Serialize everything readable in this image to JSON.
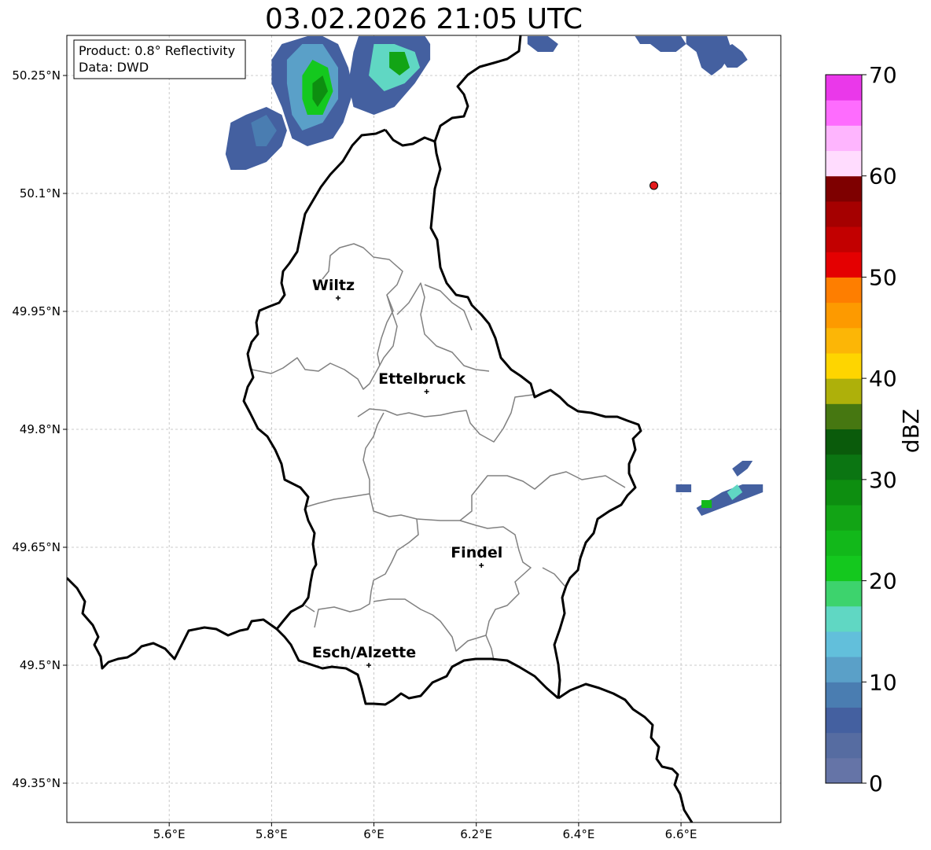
{
  "title": "03.02.2026 21:05 UTC",
  "info_box": {
    "product": "Product: 0.8° Reflectivity",
    "source": "Data: DWD"
  },
  "map": {
    "lon_range": [
      5.4,
      6.795
    ],
    "lat_range": [
      49.3,
      50.301
    ],
    "gridlines": true,
    "lon_ticks": [
      {
        "value": 5.6,
        "label": "5.6°E"
      },
      {
        "value": 5.8,
        "label": "5.8°E"
      },
      {
        "value": 6.0,
        "label": "6°E"
      },
      {
        "value": 6.2,
        "label": "6.2°E"
      },
      {
        "value": 6.4,
        "label": "6.4°E"
      },
      {
        "value": 6.6,
        "label": "6.6°E"
      }
    ],
    "lat_ticks": [
      {
        "value": 50.25,
        "label": "50.25°N"
      },
      {
        "value": 50.1,
        "label": "50.1°N"
      },
      {
        "value": 49.95,
        "label": "49.95°N"
      },
      {
        "value": 49.8,
        "label": "49.8°N"
      },
      {
        "value": 49.65,
        "label": "49.65°N"
      },
      {
        "value": 49.5,
        "label": "49.5°N"
      },
      {
        "value": 49.35,
        "label": "49.35°N"
      }
    ],
    "cities": [
      {
        "name": "Wiltz",
        "lon": 5.93,
        "lat": 49.967
      },
      {
        "name": "Ettelbruck",
        "lon": 6.103,
        "lat": 49.848
      },
      {
        "name": "Findel",
        "lon": 6.21,
        "lat": 49.627
      },
      {
        "name": "Esch/Alzette",
        "lon": 5.99,
        "lat": 49.5
      }
    ],
    "radar_site": {
      "lon": 6.547,
      "lat": 50.11,
      "color": "#e41a1c"
    }
  },
  "colorbar": {
    "label": "dBZ",
    "min": 0,
    "max": 70,
    "step": 5,
    "ticks": [
      "0",
      "10",
      "20",
      "30",
      "40",
      "50",
      "60",
      "70"
    ],
    "colors": [
      "#6574a7",
      "#566ca1",
      "#4460a0",
      "#4a7db1",
      "#5aa0c8",
      "#62bfdb",
      "#60d7c3",
      "#3dd36d",
      "#14c81e",
      "#12b81a",
      "#12a415",
      "#0d8e10",
      "#0b7512",
      "#0a5b0b",
      "#467711",
      "#aeb00a",
      "#fed500",
      "#fcb606",
      "#fd9a00",
      "#fe7e00",
      "#e40001",
      "#c20000",
      "#a50000",
      "#7e0000",
      "#ffdcfe",
      "#feb5fe",
      "#fe6cfe",
      "#ea38ea"
    ]
  },
  "radar_echoes": [
    {
      "level": 2,
      "points": [
        [
          5.8,
          50.27
        ],
        [
          5.82,
          50.29
        ],
        [
          5.87,
          50.3
        ],
        [
          5.9,
          50.3
        ],
        [
          5.93,
          50.29
        ],
        [
          5.95,
          50.26
        ],
        [
          5.96,
          50.23
        ],
        [
          5.94,
          50.19
        ],
        [
          5.92,
          50.17
        ],
        [
          5.87,
          50.16
        ],
        [
          5.84,
          50.17
        ],
        [
          5.82,
          50.21
        ],
        [
          5.8,
          50.24
        ]
      ]
    },
    {
      "level": 4,
      "points": [
        [
          5.83,
          50.27
        ],
        [
          5.86,
          50.29
        ],
        [
          5.9,
          50.29
        ],
        [
          5.93,
          50.26
        ],
        [
          5.93,
          50.22
        ],
        [
          5.9,
          50.19
        ],
        [
          5.86,
          50.18
        ],
        [
          5.84,
          50.2
        ],
        [
          5.83,
          50.24
        ]
      ]
    },
    {
      "level": 8,
      "points": [
        [
          5.86,
          50.25
        ],
        [
          5.88,
          50.27
        ],
        [
          5.91,
          50.26
        ],
        [
          5.92,
          50.23
        ],
        [
          5.9,
          50.2
        ],
        [
          5.87,
          50.2
        ],
        [
          5.86,
          50.22
        ]
      ]
    },
    {
      "level": 11,
      "points": [
        [
          5.88,
          50.24
        ],
        [
          5.9,
          50.25
        ],
        [
          5.91,
          50.23
        ],
        [
          5.89,
          50.21
        ],
        [
          5.88,
          50.22
        ]
      ]
    },
    {
      "level": 2,
      "points": [
        [
          5.72,
          50.19
        ],
        [
          5.75,
          50.2
        ],
        [
          5.79,
          50.21
        ],
        [
          5.82,
          50.2
        ],
        [
          5.83,
          50.18
        ],
        [
          5.82,
          50.16
        ],
        [
          5.79,
          50.14
        ],
        [
          5.75,
          50.13
        ],
        [
          5.72,
          50.13
        ],
        [
          5.71,
          50.15
        ]
      ]
    },
    {
      "level": 3,
      "points": [
        [
          5.76,
          50.19
        ],
        [
          5.79,
          50.2
        ],
        [
          5.81,
          50.18
        ],
        [
          5.79,
          50.16
        ],
        [
          5.77,
          50.16
        ]
      ]
    },
    {
      "level": 2,
      "points": [
        [
          5.97,
          50.3
        ],
        [
          6.01,
          50.3
        ],
        [
          6.06,
          50.3
        ],
        [
          6.1,
          50.3
        ],
        [
          6.11,
          50.29
        ],
        [
          6.11,
          50.27
        ],
        [
          6.08,
          50.24
        ],
        [
          6.04,
          50.21
        ],
        [
          6.0,
          50.2
        ],
        [
          5.96,
          50.21
        ],
        [
          5.95,
          50.24
        ],
        [
          5.96,
          50.28
        ]
      ]
    },
    {
      "level": 6,
      "points": [
        [
          6.0,
          50.29
        ],
        [
          6.04,
          50.29
        ],
        [
          6.08,
          50.28
        ],
        [
          6.09,
          50.26
        ],
        [
          6.06,
          50.24
        ],
        [
          6.02,
          50.23
        ],
        [
          5.99,
          50.25
        ]
      ]
    },
    {
      "level": 10,
      "points": [
        [
          6.03,
          50.28
        ],
        [
          6.06,
          50.28
        ],
        [
          6.07,
          50.26
        ],
        [
          6.05,
          50.25
        ],
        [
          6.03,
          50.26
        ]
      ]
    },
    {
      "level": 2,
      "points": [
        [
          6.3,
          50.3
        ],
        [
          6.34,
          50.3
        ],
        [
          6.36,
          50.29
        ],
        [
          6.35,
          50.28
        ],
        [
          6.32,
          50.28
        ],
        [
          6.3,
          50.29
        ]
      ]
    },
    {
      "level": 2,
      "points": [
        [
          6.51,
          50.3
        ],
        [
          6.55,
          50.3
        ],
        [
          6.6,
          50.3
        ],
        [
          6.61,
          50.29
        ],
        [
          6.59,
          50.28
        ],
        [
          6.56,
          50.28
        ],
        [
          6.54,
          50.29
        ],
        [
          6.52,
          50.29
        ]
      ]
    },
    {
      "level": 2,
      "points": [
        [
          6.61,
          50.3
        ],
        [
          6.66,
          50.3
        ],
        [
          6.69,
          50.3
        ],
        [
          6.7,
          50.28
        ],
        [
          6.68,
          50.26
        ],
        [
          6.66,
          50.25
        ],
        [
          6.64,
          50.26
        ],
        [
          6.63,
          50.28
        ],
        [
          6.61,
          50.29
        ]
      ]
    },
    {
      "level": 2,
      "points": [
        [
          6.67,
          50.28
        ],
        [
          6.7,
          50.29
        ],
        [
          6.72,
          50.28
        ],
        [
          6.73,
          50.27
        ],
        [
          6.71,
          50.26
        ],
        [
          6.69,
          50.26
        ]
      ]
    },
    {
      "level": 2,
      "points": [
        [
          6.59,
          49.73
        ],
        [
          6.62,
          49.73
        ],
        [
          6.62,
          49.72
        ],
        [
          6.59,
          49.72
        ]
      ]
    },
    {
      "level": 2,
      "points": [
        [
          6.63,
          49.7
        ],
        [
          6.68,
          49.72
        ],
        [
          6.72,
          49.73
        ],
        [
          6.76,
          49.73
        ],
        [
          6.76,
          49.72
        ],
        [
          6.72,
          49.71
        ],
        [
          6.68,
          49.7
        ],
        [
          6.64,
          49.69
        ]
      ]
    },
    {
      "level": 6,
      "points": [
        [
          6.69,
          49.72
        ],
        [
          6.71,
          49.73
        ],
        [
          6.72,
          49.72
        ],
        [
          6.7,
          49.71
        ]
      ]
    },
    {
      "level": 9,
      "points": [
        [
          6.64,
          49.71
        ],
        [
          6.66,
          49.71
        ],
        [
          6.66,
          49.7
        ],
        [
          6.64,
          49.7
        ]
      ]
    },
    {
      "level": 2,
      "points": [
        [
          6.7,
          49.75
        ],
        [
          6.72,
          49.76
        ],
        [
          6.74,
          49.76
        ],
        [
          6.73,
          49.75
        ],
        [
          6.71,
          49.74
        ]
      ]
    }
  ]
}
